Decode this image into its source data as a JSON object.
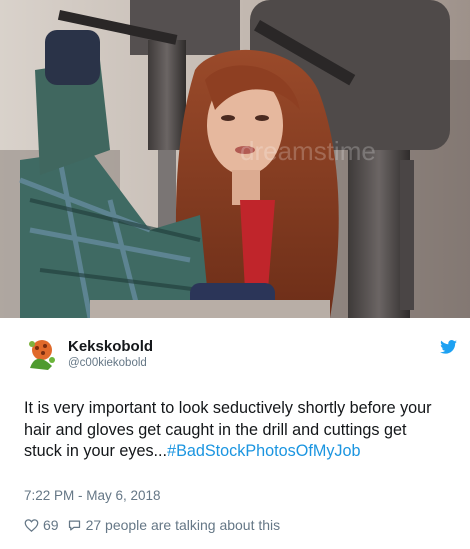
{
  "photo": {
    "watermark": "dreamstime",
    "colors": {
      "background": "#c9c0b8",
      "hair": "#8a3d22",
      "skin": "#e4b59b",
      "machine": "#5a5554",
      "glove": "#2a3348"
    }
  },
  "tweet": {
    "author_name": "Kekskobold",
    "author_handle": "@c00kiekobold",
    "text_before": "It is very important to look seductively shortly before your hair and gloves get caught in the drill and cuttings get stuck in your eyes...",
    "hashtag": "#BadStockPhotosOfMyJob",
    "timestamp": "7:22 PM - May 6, 2018",
    "likes_count": "69",
    "talking_text": "27 people are talking about this"
  },
  "icons": {
    "avatar": "cookie-avatar-icon",
    "brand": "twitter-bird-icon",
    "like": "heart-icon",
    "reply": "speech-bubble-icon"
  },
  "colors": {
    "text": "#14171a",
    "muted": "#657786",
    "link": "#1b95e0",
    "twitter_blue": "#1da1f2"
  }
}
